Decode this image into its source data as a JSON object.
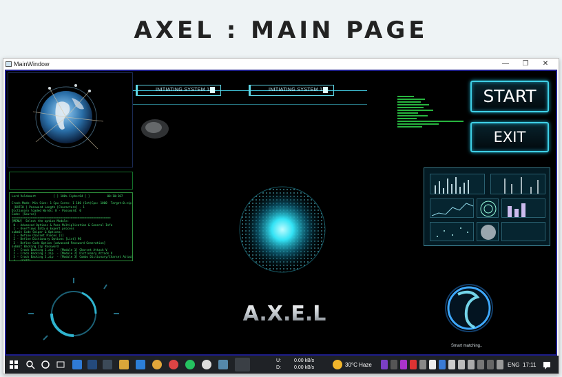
{
  "page_title": "AXEL : MAIN PAGE",
  "window": {
    "title": "MainWindow",
    "minimize": "—",
    "restore": "❐",
    "close": "✕"
  },
  "banners": [
    "INITIATING SYSTEM 1....",
    "INITIATING SYSTEM 1...."
  ],
  "buttons": {
    "start": "START",
    "exit": "EXIT"
  },
  "logo_text": "A.X.E.L",
  "voice_status": "Smart matching..",
  "terminal_text": "Lord Voldemort          [ ] 100% Cipher64 [ ]          00:10:307\n\nCrack Mode: Min Size: 1 Cpu Cores: 1 100 (Set)Cpu: 1000  Target:0.zip\n [BATCH ] Password Length [Characters] - 1\nDictionary loaded Words: 0 - Password: 0\nCode: [Source]\n=========================================================\n[MENU]  Select the option Module:\n 0 - Advanced Options & Pass Multiplication & General Info\n 1 - Overflows Data & Expert process\nsubmit Code Sniper & Options:\n 1 - Define Charset Pieces [1]\n 2 - Define Dictionary Options [List] 90\n 3 - Define Code Option [advanced Password Generation]\nsubmit Backing Zip Password\n 1 - Crack Backing 1.zip  - [Module 1] Charset Attack V\n 2 - Crack Backing 2.zip  - [Module 2] Dictionary Attack V\n 3 - Crack Backing 3.zip  - [Module 3] Combo Dictionary/Charset Attack V\n 4 - [EXIT]\n>",
  "taskbar": {
    "net_up_label": "U:",
    "net_down_label": "D:",
    "net_up": "0.00 kB/s",
    "net_down": "0.00 kB/s",
    "weather": "30°C  Haze",
    "language": "ENG",
    "time": "17:11"
  },
  "colors": {
    "hud_cyan": "#3fd0e6",
    "terminal_green": "#47e070",
    "window_border": "#1d1d8a"
  }
}
